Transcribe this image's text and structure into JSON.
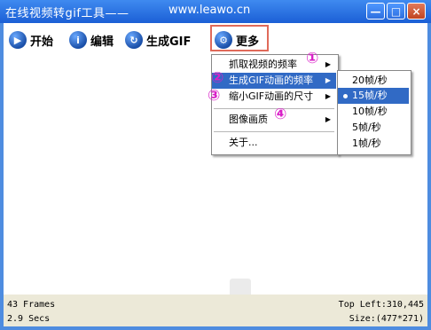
{
  "window": {
    "title_left": "在线视频转gif工具——",
    "title_right": "www.leawo.cn",
    "min_label": "—",
    "max_label": "□",
    "close_label": "×",
    "colors": {
      "titlebar": "#1b5fd6",
      "highlight": "#316ac5",
      "annotation": "#d91fc8",
      "callout_box": "#e06a5a"
    }
  },
  "toolbar": {
    "start_label": "开始",
    "edit_label": "编辑",
    "generate_label": "生成GIF",
    "more_label": "更多",
    "icons": [
      "play-icon",
      "info-icon",
      "refresh-icon",
      "gear-icon"
    ]
  },
  "menu": {
    "items": [
      {
        "label": "抓取视频的频率",
        "annotation": "①"
      },
      {
        "label": "生成GIF动画的频率",
        "annotation": "②"
      },
      {
        "label": "缩小GIF动画的尺寸",
        "annotation": "③"
      },
      {
        "label": "图像画质",
        "annotation": "④"
      },
      {
        "label": "关于..."
      }
    ],
    "arrow": "▶"
  },
  "submenu": {
    "items": [
      {
        "label": "20帧/秒",
        "checked": false
      },
      {
        "label": "15帧/秒",
        "checked": true
      },
      {
        "label": "10帧/秒",
        "checked": false
      },
      {
        "label": "5帧/秒",
        "checked": false
      },
      {
        "label": "1帧/秒",
        "checked": false
      }
    ]
  },
  "status": {
    "frames": "43 Frames",
    "secs": "2.9 Secs",
    "top_left": "Top Left:310,445",
    "size": "Size:(477*271)"
  }
}
